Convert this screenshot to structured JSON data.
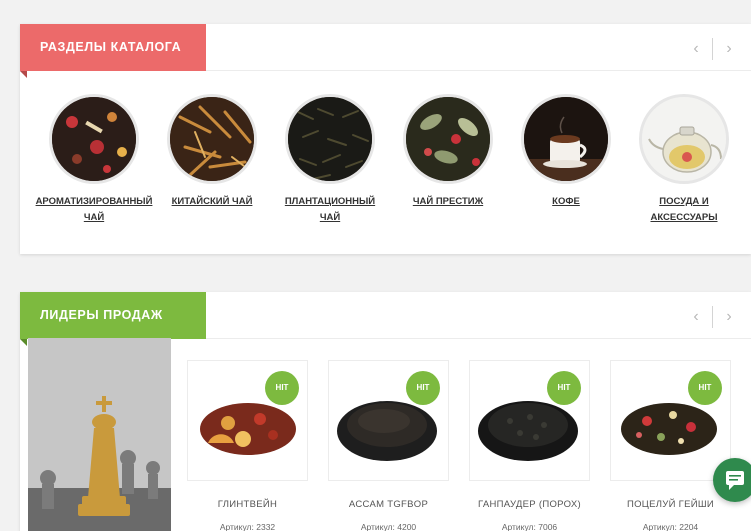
{
  "catalog": {
    "title": "РАЗДЕЛЫ КАТАЛОГА",
    "accent": "#ec6a6a",
    "nav": {
      "prev": "‹",
      "next": "›"
    },
    "items": [
      {
        "label_line1": "АРОМАТИЗИРОВАННЫЙ",
        "label_line2": "ЧАЙ"
      },
      {
        "label_line1": "КИТАЙСКИЙ ЧАЙ",
        "label_line2": ""
      },
      {
        "label_line1": "ПЛАНТАЦИОННЫЙ",
        "label_line2": "ЧАЙ"
      },
      {
        "label_line1": "ЧАЙ ПРЕСТИЖ",
        "label_line2": ""
      },
      {
        "label_line1": "КОФЕ",
        "label_line2": ""
      },
      {
        "label_line1": "ПОСУДА И",
        "label_line2": "АКСЕССУАРЫ"
      }
    ]
  },
  "leaders": {
    "title": "ЛИДЕРЫ ПРОДАЖ",
    "accent": "#7dba3f",
    "nav": {
      "prev": "‹",
      "next": "›"
    },
    "products": [
      {
        "badge": "HIT",
        "name": "ГЛИНТВЕЙН",
        "sku": "Артикул: 2332"
      },
      {
        "badge": "HIT",
        "name": "АССАМ TGFBOP",
        "sku": "Артикул: 4200"
      },
      {
        "badge": "HIT",
        "name": "ГАНПАУДЕР (ПОРОХ)",
        "sku": "Артикул: 7006"
      },
      {
        "badge": "HIT",
        "name": "ПОЦЕЛУЙ ГЕЙШИ",
        "sku": "Артикул: 2204"
      }
    ]
  },
  "icons": {
    "chat": "chat-icon",
    "chess": "chess-king-image"
  }
}
